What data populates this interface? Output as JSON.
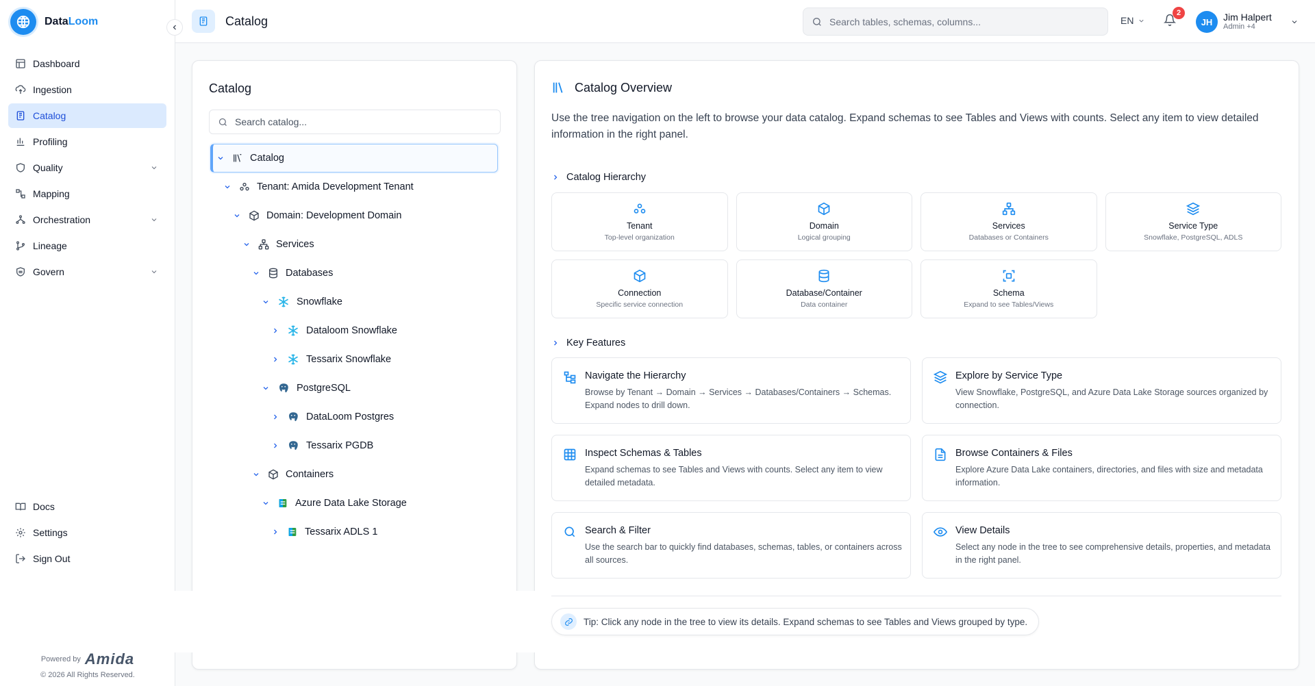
{
  "app": {
    "name_prefix": "Data",
    "name_accent": "Loom"
  },
  "sidebar": {
    "items": [
      {
        "label": "Dashboard",
        "icon": "dashboard-icon"
      },
      {
        "label": "Ingestion",
        "icon": "cloud-upload-icon"
      },
      {
        "label": "Catalog",
        "icon": "catalog-icon",
        "active": true
      },
      {
        "label": "Profiling",
        "icon": "bar-chart-icon"
      },
      {
        "label": "Quality",
        "icon": "shield-icon",
        "expandable": true
      },
      {
        "label": "Mapping",
        "icon": "mapping-icon"
      },
      {
        "label": "Orchestration",
        "icon": "workflow-icon",
        "expandable": true
      },
      {
        "label": "Lineage",
        "icon": "git-branch-icon"
      },
      {
        "label": "Govern",
        "icon": "govern-icon",
        "expandable": true
      }
    ],
    "bottom_items": [
      {
        "label": "Docs",
        "icon": "book-icon"
      },
      {
        "label": "Settings",
        "icon": "gear-icon"
      },
      {
        "label": "Sign Out",
        "icon": "sign-out-icon"
      }
    ],
    "powered_by": "Powered by",
    "powered_brand": "Amida",
    "copyright": "© 2026 All Rights Reserved."
  },
  "header": {
    "title": "Catalog",
    "search_placeholder": "Search tables, schemas, columns...",
    "language": "EN",
    "notification_count": "2",
    "user_initials": "JH",
    "user_name": "Jim Halpert",
    "user_role": "Admin +4"
  },
  "catalog_panel": {
    "title": "Catalog",
    "search_placeholder": "Search catalog...",
    "tree": [
      {
        "label": "Catalog",
        "icon": "library-icon",
        "level": 0,
        "expanded": true,
        "selected": true
      },
      {
        "label": "Tenant: Amida Development Tenant",
        "icon": "tenant-icon",
        "level": 1,
        "expanded": true
      },
      {
        "label": "Domain: Development Domain",
        "icon": "cube-icon",
        "level": 2,
        "expanded": true
      },
      {
        "label": "Services",
        "icon": "services-icon",
        "level": 3,
        "expanded": true
      },
      {
        "label": "Databases",
        "icon": "database-icon",
        "level": 4,
        "expanded": true
      },
      {
        "label": "Snowflake",
        "icon": "snowflake-icon",
        "level": 5,
        "expanded": true
      },
      {
        "label": "Dataloom Snowflake",
        "icon": "snowflake-icon",
        "level": 6,
        "expanded": false
      },
      {
        "label": "Tessarix Snowflake",
        "icon": "snowflake-icon",
        "level": 6,
        "expanded": false
      },
      {
        "label": "PostgreSQL",
        "icon": "postgres-icon",
        "level": 5,
        "expanded": true
      },
      {
        "label": "DataLoom Postgres",
        "icon": "postgres-icon",
        "level": 6,
        "expanded": false
      },
      {
        "label": "Tessarix PGDB",
        "icon": "postgres-icon",
        "level": 6,
        "expanded": false
      },
      {
        "label": "Containers",
        "icon": "cube-icon",
        "level": 4,
        "expanded": true
      },
      {
        "label": "Azure Data Lake Storage",
        "icon": "adls-icon",
        "level": 5,
        "expanded": true
      },
      {
        "label": "Tessarix ADLS 1",
        "icon": "adls-icon",
        "level": 6,
        "expanded": false
      }
    ]
  },
  "overview": {
    "title": "Catalog Overview",
    "intro": "Use the tree navigation on the left to browse your data catalog. Expand schemas to see Tables and Views with counts. Select any item to view detailed information in the right panel.",
    "hierarchy_heading": "Catalog Hierarchy",
    "hierarchy": [
      {
        "title": "Tenant",
        "subtitle": "Top-level organization",
        "icon": "tenant-icon"
      },
      {
        "title": "Domain",
        "subtitle": "Logical grouping",
        "icon": "cube-icon"
      },
      {
        "title": "Services",
        "subtitle": "Databases or Containers",
        "icon": "services-icon"
      },
      {
        "title": "Service Type",
        "subtitle": "Snowflake, PostgreSQL, ADLS",
        "icon": "layers-icon"
      },
      {
        "title": "Connection",
        "subtitle": "Specific service connection",
        "icon": "cube-icon"
      },
      {
        "title": "Database/Container",
        "subtitle": "Data container",
        "icon": "database-icon"
      },
      {
        "title": "Schema",
        "subtitle": "Expand to see Tables/Views",
        "icon": "schema-icon"
      }
    ],
    "features_heading": "Key Features",
    "features": [
      {
        "title": "Navigate the Hierarchy",
        "desc": "Browse by Tenant → Domain → Services → Databases/Containers → Schemas. Expand nodes to drill down.",
        "icon": "hierarchy-icon"
      },
      {
        "title": "Explore by Service Type",
        "desc": "View Snowflake, PostgreSQL, and Azure Data Lake Storage sources organized by connection.",
        "icon": "layers-icon"
      },
      {
        "title": "Inspect Schemas & Tables",
        "desc": "Expand schemas to see Tables and Views with counts. Select any item to view detailed metadata.",
        "icon": "table-icon"
      },
      {
        "title": "Browse Containers & Files",
        "desc": "Explore Azure Data Lake containers, directories, and files with size and metadata information.",
        "icon": "file-icon"
      },
      {
        "title": "Search & Filter",
        "desc": "Use the search bar to quickly find databases, schemas, tables, or containers across all sources.",
        "icon": "search-icon"
      },
      {
        "title": "View Details",
        "desc": "Select any node in the tree to see comprehensive details, properties, and metadata in the right panel.",
        "icon": "eye-icon"
      }
    ],
    "tip": "Tip: Click any node in the tree to view its details. Expand schemas to see Tables and Views grouped by type."
  },
  "colors": {
    "accent": "#1d8cf0",
    "active_bg": "#dbeafe",
    "badge": "#ef4444"
  }
}
